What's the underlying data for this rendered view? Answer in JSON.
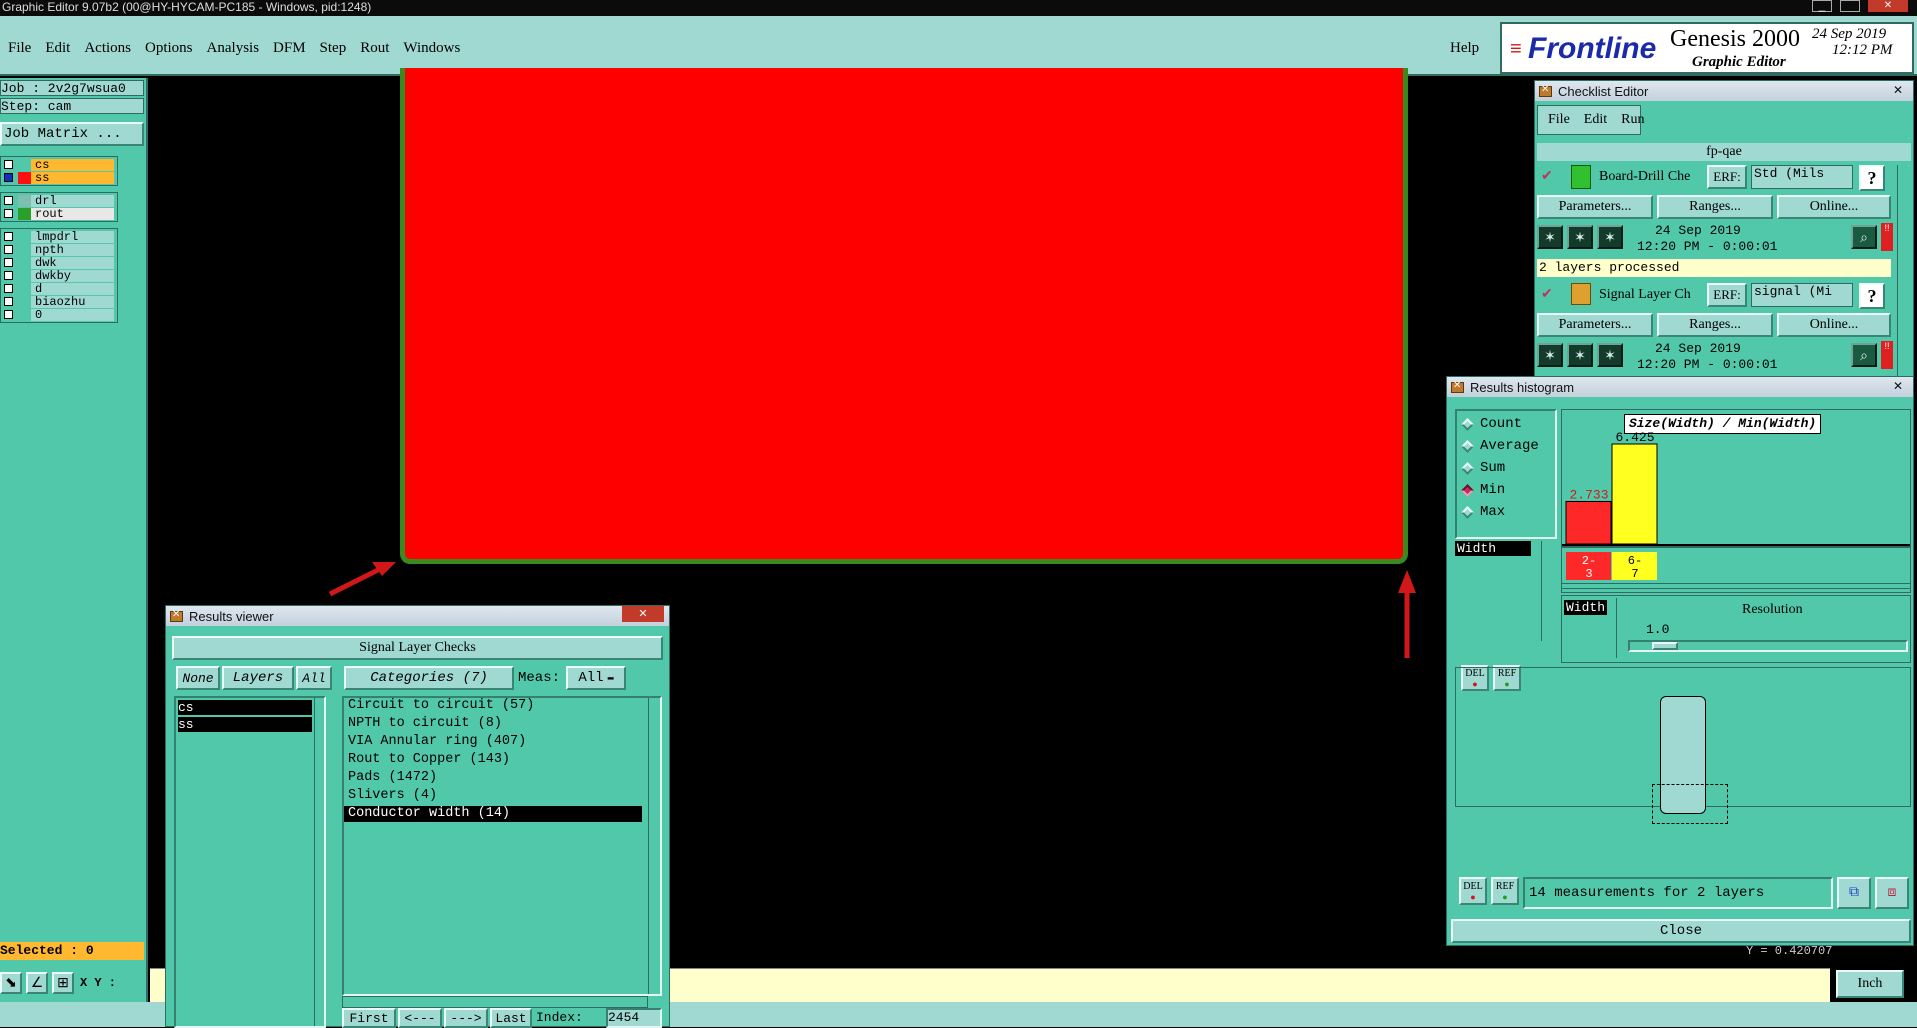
{
  "window": {
    "title": "Graphic Editor 9.07b2 (00@HY-HYCAM-PC185 - Windows, pid:1248)"
  },
  "menu": {
    "items": [
      "File",
      "Edit",
      "Actions",
      "Options",
      "Analysis",
      "DFM",
      "Step",
      "Rout",
      "Windows"
    ],
    "help": "Help"
  },
  "brand": {
    "logo": "Frontline",
    "product": "Genesis 2000",
    "subtitle": "Graphic Editor",
    "date": "24 Sep 2019",
    "time": "12:12 PM"
  },
  "left": {
    "job": "Job : 2v2g7wsua0",
    "step": "Step: cam",
    "job_matrix": "Job Matrix ...",
    "layers_group1": [
      {
        "name": "cs",
        "color": "#ffb830"
      },
      {
        "name": "ss",
        "color": "#ffb830"
      }
    ],
    "layers_group2": [
      {
        "name": "drl",
        "color": "#9fd9d2"
      },
      {
        "name": "rout",
        "color": "#e8e8e8"
      }
    ],
    "layers_group3": [
      "lmpdrl",
      "npth",
      "dwk",
      "dwkby",
      "d",
      "biaozhu",
      "0"
    ],
    "selected": "Selected : 0",
    "xy_label": "X Y :"
  },
  "results_viewer": {
    "title": "Results viewer",
    "header": "Signal Layer Checks",
    "none": "None",
    "layers": "Layers",
    "all": "All",
    "categories": "Categories (7)",
    "meas_label": "Meas:",
    "meas_value": "All",
    "layer_list": [
      "cs",
      "ss"
    ],
    "category_list": [
      "Circuit to circuit (57)",
      "NPTH to circuit (8)",
      "VIA Annular ring (407)",
      "Rout to Copper (143)",
      "Pads (1472)",
      "Slivers (4)",
      "Conductor width (14)"
    ],
    "nav": {
      "first": "First",
      "prev": "<---",
      "next": "--->",
      "last": "Last",
      "index_label": "Index:",
      "index_value": "2454"
    }
  },
  "checklist": {
    "title": "Checklist Editor",
    "menu": [
      "File",
      "Edit",
      "Run"
    ],
    "name": "fp-qae",
    "checks": [
      {
        "name": "Board-Drill Che",
        "erf": "ERF:",
        "erf_value": "Std (Mils",
        "params": "Parameters...",
        "ranges": "Ranges...",
        "online": "Online...",
        "date": "24 Sep 2019",
        "time": "12:20 PM - 0:00:01",
        "status": "2 layers processed"
      },
      {
        "name": "Signal Layer Ch",
        "erf": "ERF:",
        "erf_value": "signal (Mi",
        "params": "Parameters...",
        "ranges": "Ranges...",
        "online": "Online...",
        "date": "24 Sep 2019",
        "time": "12:20 PM - 0:00:01"
      }
    ],
    "help": "?"
  },
  "histogram": {
    "title": "Results histogram",
    "options": [
      "Count",
      "Average",
      "Sum",
      "Min",
      "Max"
    ],
    "selected": "Min",
    "attr_list": [
      "Width"
    ],
    "chart_title": "Size(Width) / Min(Width)",
    "resolution_label": "Resolution",
    "resolution_value": "1.0",
    "width_tag": "Width",
    "del": "DEL",
    "ref": "REF",
    "measurements": "14 measurements for 2 layers",
    "close": "Close"
  },
  "chart_data": {
    "type": "bar",
    "title": "Size(Width) / Min(Width)",
    "categories": [
      "2-3",
      "6-7"
    ],
    "values": [
      2.733,
      6.425
    ],
    "colors": [
      "#ff2828",
      "#ffff20"
    ],
    "ylim": [
      0,
      6.425
    ]
  },
  "status": {
    "units": "Inch",
    "y_readout": "Y = 0.420707"
  },
  "colors": {
    "teal": "#52c8aa",
    "light_teal": "#9fd9d2",
    "board": "#ff0000",
    "outline": "#3a8a22",
    "arrow": "#d01818",
    "yellow": "#ffffcc"
  }
}
